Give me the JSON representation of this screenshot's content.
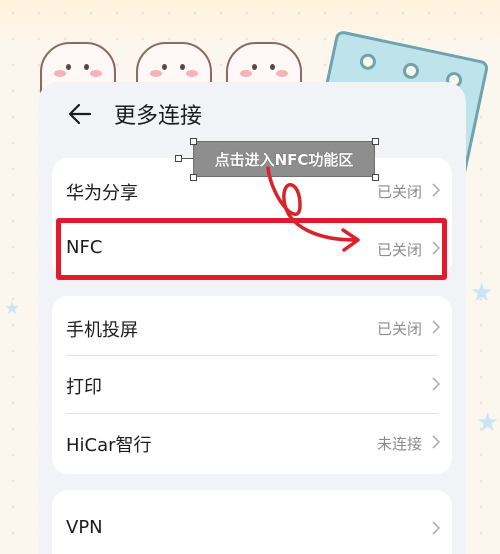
{
  "header": {
    "title": "更多连接"
  },
  "annotation": {
    "text": "点击进入NFC功能区"
  },
  "groups": [
    {
      "rows": [
        {
          "label": "华为分享",
          "status": "已关闭"
        },
        {
          "label": "NFC",
          "status": "已关闭"
        }
      ]
    },
    {
      "rows": [
        {
          "label": "手机投屏",
          "status": "已关闭"
        },
        {
          "label": "打印",
          "status": ""
        },
        {
          "label": "HiCar智行",
          "status": "未连接"
        }
      ]
    },
    {
      "rows": [
        {
          "label": "VPN",
          "status": ""
        }
      ]
    }
  ],
  "colors": {
    "highlight": "#e4192c",
    "arrow": "#d8232a",
    "panel": "#f1f3f6"
  },
  "icons": {
    "back": "arrow-left-icon",
    "chevron": "chevron-right-icon"
  }
}
